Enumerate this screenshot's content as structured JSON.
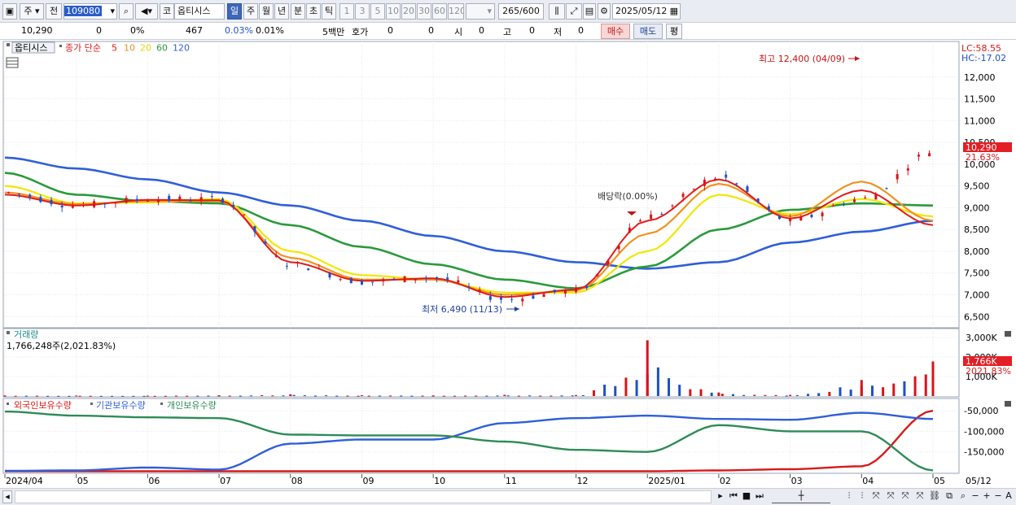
{
  "toolbar": {
    "market": "주",
    "prev": "전",
    "code": "109080",
    "name_prefix": "코",
    "name": "옵티시스",
    "periods": [
      "일",
      "주",
      "월",
      "년",
      "분",
      "초",
      "틱"
    ],
    "selected_period": "일",
    "intervals": [
      "1",
      "3",
      "5",
      "10",
      "20",
      "30",
      "60",
      "120"
    ],
    "count": "265",
    "count_total": "/600",
    "date": "2025/05/12"
  },
  "quote": {
    "price": "10,290",
    "change": "0",
    "change_pct": "0%",
    "volume": "467",
    "vol_pct": "0.03%",
    "turnover_pct": "0.01%",
    "unit": "5백만",
    "ask_label": "호가",
    "ask1": "0",
    "ask2": "0",
    "open_label": "시",
    "open": "0",
    "high_label": "고",
    "high": "0",
    "low_label": "저",
    "low": "0",
    "buy": "매수",
    "sell": "매도",
    "eval": "평"
  },
  "price_panel": {
    "name_tag": "옵티시스",
    "legend_main": "종가 단순",
    "ma_periods": [
      "5",
      "10",
      "20",
      "60",
      "120"
    ],
    "lc": "LC:58.55",
    "hc": "HC:-17.02",
    "high_note": "최고 12,400 (04/09)",
    "low_note": "최저 6,490 (11/13)",
    "dividend_note": "배당락(0.00%)",
    "last_price": "10,290",
    "last_pct": "21.63%",
    "y_ticks": [
      "12,000",
      "11,500",
      "11,000",
      "10,500",
      "10,000",
      "9,500",
      "9,000",
      "8,500",
      "8,000",
      "7,500",
      "7,000",
      "6,500"
    ]
  },
  "volume_panel": {
    "title": "거래량",
    "value": "1,766,248주(2,021.83%)",
    "y_ticks": [
      "3,000K",
      "2,000K",
      "1,000K"
    ],
    "last": "1,766K",
    "last_pct": "2021.83%"
  },
  "holdings_panel": {
    "legend": [
      "외국인보유수량",
      "기관보유수량",
      "개인보유수량"
    ],
    "y_ticks": [
      "-50,000",
      "-100,000",
      "-150,000"
    ]
  },
  "x_axis": {
    "labels": [
      "2024/04",
      "05",
      "06",
      "07",
      "08",
      "09",
      "10",
      "11",
      "12",
      "2025/01",
      "02",
      "03",
      "04",
      "05"
    ],
    "end_label": "05/12"
  },
  "colors": {
    "ma5": "#e01b1b",
    "ma10": "#f0921f",
    "ma20": "#f2e600",
    "ma60": "#2a9a3a",
    "ma120": "#2f5fd8",
    "up": "#d7141a",
    "down": "#1f4fc8",
    "foreign": "#d71a1a",
    "institution": "#2f5fd8",
    "individual": "#2e8b57"
  },
  "chart_data": [
    {
      "type": "line",
      "title": "옵티시스",
      "x": [
        "2024/04",
        "05",
        "06",
        "07",
        "08",
        "09",
        "10",
        "11",
        "12",
        "2025/01",
        "02",
        "03",
        "04",
        "05"
      ],
      "ylim": [
        6300,
        12500
      ],
      "series": [
        {
          "name": "종가",
          "values": [
            9350,
            9050,
            9200,
            9200,
            7700,
            7300,
            7400,
            6900,
            7100,
            8800,
            9700,
            8700,
            9200,
            10290
          ]
        },
        {
          "name": "5",
          "values": [
            9300,
            9050,
            9180,
            9170,
            7750,
            7320,
            7380,
            6950,
            7120,
            8700,
            9650,
            8750,
            9400,
            8600
          ]
        },
        {
          "name": "10",
          "values": [
            9350,
            9080,
            9150,
            9150,
            7850,
            7350,
            7350,
            7000,
            7100,
            8400,
            9550,
            8800,
            9600,
            8700
          ]
        },
        {
          "name": "20",
          "values": [
            9500,
            9100,
            9120,
            9200,
            8000,
            7450,
            7350,
            7050,
            7050,
            8000,
            9300,
            8850,
            9200,
            8800
          ]
        },
        {
          "name": "60",
          "values": [
            9800,
            9300,
            9150,
            9100,
            8600,
            8100,
            7700,
            7350,
            7150,
            7650,
            8500,
            8950,
            9100,
            9050
          ]
        },
        {
          "name": "120",
          "values": [
            10150,
            9900,
            9650,
            9350,
            9050,
            8700,
            8350,
            8000,
            7750,
            7600,
            7750,
            8200,
            8450,
            8700
          ]
        }
      ]
    },
    {
      "type": "bar",
      "title": "거래량",
      "categories": [
        "2024/04",
        "05",
        "06",
        "07",
        "08",
        "09",
        "10",
        "11",
        "12",
        "2025/01",
        "02",
        "03",
        "04",
        "05"
      ],
      "ylim": [
        0,
        3200
      ],
      "series": [
        {
          "name": "거래량",
          "values": [
            30,
            25,
            20,
            40,
            90,
            40,
            30,
            60,
            50,
            2850,
            180,
            60,
            820,
            1766
          ]
        }
      ]
    },
    {
      "type": "line",
      "title": "보유수량",
      "x": [
        "2024/04",
        "05",
        "06",
        "07",
        "08",
        "09",
        "10",
        "11",
        "12",
        "2025/01",
        "02",
        "03",
        "04",
        "05"
      ],
      "ylim": [
        -200000,
        -40000
      ],
      "series": [
        {
          "name": "외국인보유수량",
          "values": [
            -197000,
            -197000,
            -197000,
            -197000,
            -197000,
            -197000,
            -197000,
            -197000,
            -197000,
            -197000,
            -195000,
            -192000,
            -185000,
            -50000
          ]
        },
        {
          "name": "기관보유수량",
          "values": [
            -196000,
            -195000,
            -188000,
            -193000,
            -130000,
            -120000,
            -120000,
            -80000,
            -68000,
            -62000,
            -70000,
            -72000,
            -55000,
            -70000
          ]
        },
        {
          "name": "개인보유수량",
          "values": [
            -52000,
            -62000,
            -66000,
            -68000,
            -108000,
            -110000,
            -110000,
            -125000,
            -145000,
            -150000,
            -85000,
            -100000,
            -100000,
            -195000
          ]
        }
      ]
    }
  ]
}
